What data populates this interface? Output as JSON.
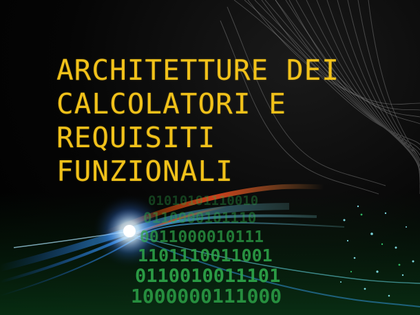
{
  "cover": {
    "title_lines": [
      "ARCHITETTURE DEI",
      "CALCOLATORI E",
      "REQUISITI",
      "FUNZIONALI"
    ]
  },
  "colors": {
    "background": "#000000",
    "title": "#f2c21a",
    "binary_digits": "#2ea84a",
    "light_streak_blue": "#3aa8ff",
    "light_streak_red": "#d8401c",
    "light_streak_cyan": "#6ff0ff"
  },
  "art": {
    "binary_rows": [
      "01010101110010",
      "0110000101110",
      "0011000010111",
      "1101110011001",
      "0110010011101",
      "1000000111000"
    ]
  },
  "icons": {
    "background": "wire-mesh-swirl",
    "foreground": "fiber-optic-light-streaks"
  }
}
